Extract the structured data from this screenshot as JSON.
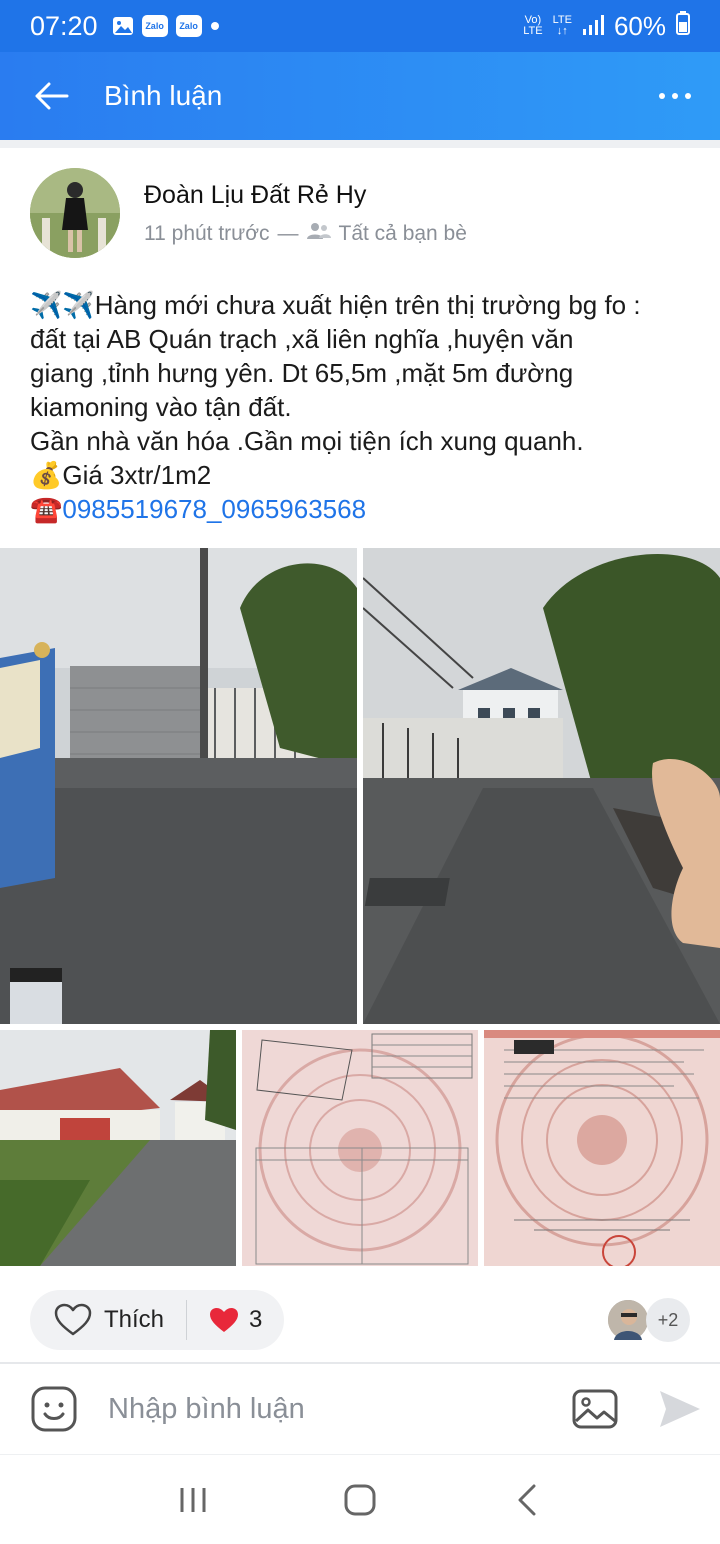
{
  "status_bar": {
    "time": "07:20",
    "network_label": "Vo) LTE",
    "lte_label": "LTE",
    "battery": "60%"
  },
  "app_bar": {
    "title": "Bình luận"
  },
  "post": {
    "author": "Đoàn Lịu Đất Rẻ Hy",
    "time_ago": "11 phút trước",
    "separator": "—",
    "audience": "Tất cả bạn bè",
    "lines": [
      "✈️✈️Hàng mới chưa xuất hiện trên thị trường bg fo :",
      "đất tại AB Quán trạch ,xã liên nghĩa ,huyện văn",
      "giang ,tỉnh hưng yên. Dt 65,5m ,mặt 5m đường",
      "kiamoning vào tận đất.",
      "Gần nhà văn hóa .Gần mọi tiện ích xung quanh.",
      "💰Giá 3xtr/1m2"
    ],
    "phone_emoji": "☎️",
    "phones": "0985519678_0965963568"
  },
  "reactions": {
    "like_label": "Thích",
    "heart_count": "3",
    "viewers_more": "+2"
  },
  "comment_bar": {
    "placeholder": "Nhập bình luận"
  },
  "colors": {
    "accent": "#1f74e8",
    "heart": "#e8283a"
  }
}
